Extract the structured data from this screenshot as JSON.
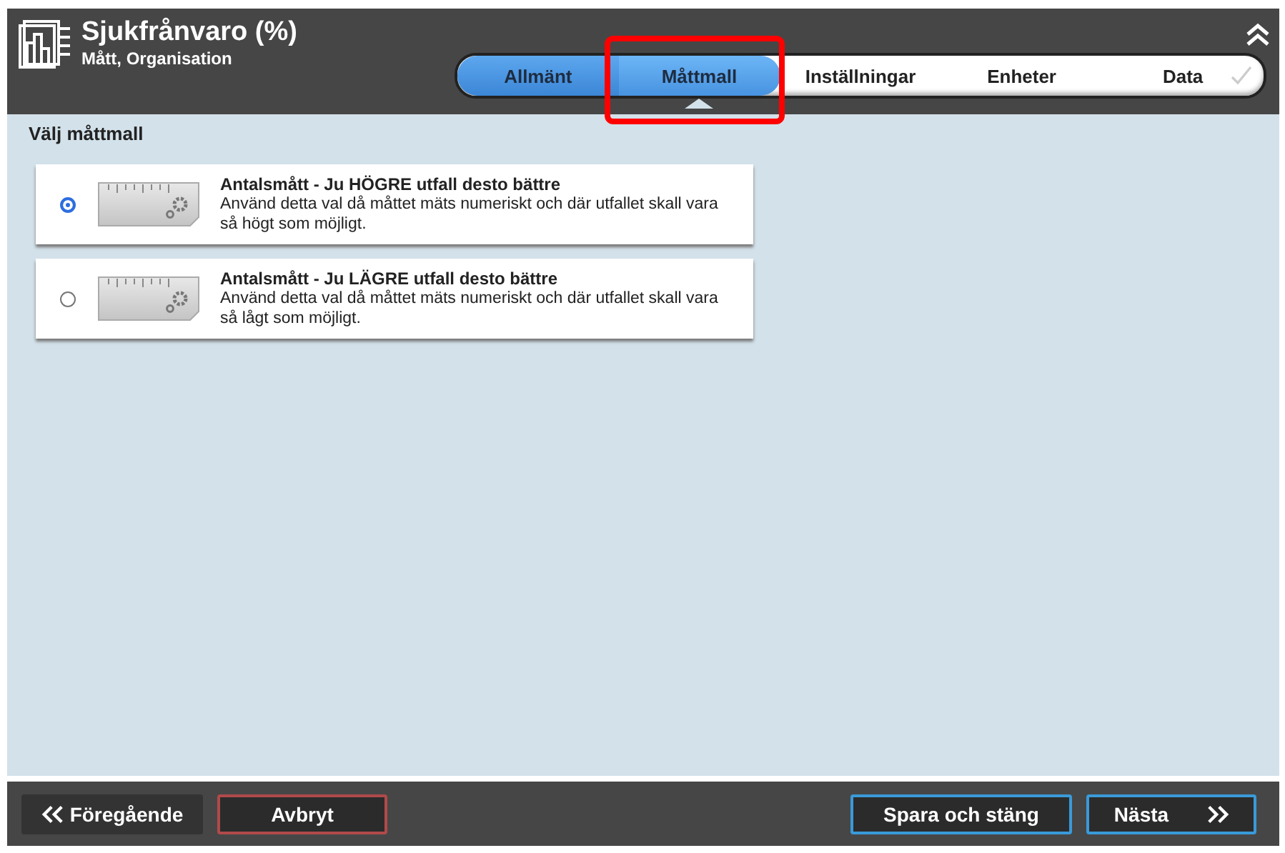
{
  "header": {
    "title": "Sjukfrånvaro (%)",
    "subtitle": "Mått, Organisation"
  },
  "steps": [
    {
      "label": "Allmänt",
      "reached": true,
      "selected": false,
      "check": false
    },
    {
      "label": "Måttmall",
      "reached": true,
      "selected": true,
      "check": false
    },
    {
      "label": "Inställningar",
      "reached": false,
      "selected": false,
      "check": false
    },
    {
      "label": "Enheter",
      "reached": false,
      "selected": false,
      "check": false
    },
    {
      "label": "Data",
      "reached": false,
      "selected": false,
      "check": true
    }
  ],
  "section_title": "Välj måttmall",
  "options": [
    {
      "title": "Antalsmått - Ju HÖGRE utfall desto bättre",
      "description": "Använd detta val då måttet mäts numeriskt och där utfallet skall vara så högt som möjligt.",
      "selected": true
    },
    {
      "title": "Antalsmått - Ju LÄGRE utfall desto bättre",
      "description": "Använd detta val då måttet mäts numeriskt och där utfallet skall vara så lågt som möjligt.",
      "selected": false
    }
  ],
  "footer_buttons": [
    {
      "label": "Föregående",
      "kind": "back"
    },
    {
      "label": "Avbryt",
      "kind": "cancel"
    },
    {
      "label": "Spara och stäng",
      "kind": "save"
    },
    {
      "label": "Nästa",
      "kind": "next"
    }
  ]
}
